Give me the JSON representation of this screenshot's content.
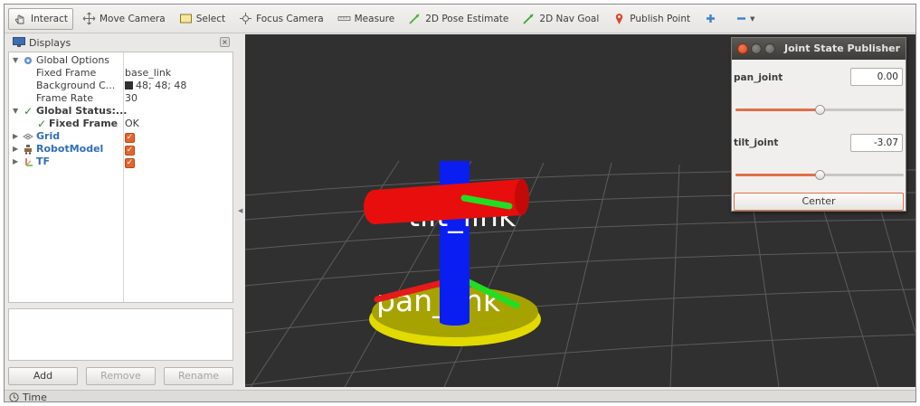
{
  "toolbar": {
    "items": [
      {
        "label": "Interact",
        "icon": "interact-icon"
      },
      {
        "label": "Move Camera",
        "icon": "move-camera-icon"
      },
      {
        "label": "Select",
        "icon": "select-icon"
      },
      {
        "label": "Focus Camera",
        "icon": "focus-camera-icon"
      },
      {
        "label": "Measure",
        "icon": "measure-icon"
      },
      {
        "label": "2D Pose Estimate",
        "icon": "pose-estimate-icon"
      },
      {
        "label": "2D Nav Goal",
        "icon": "nav-goal-icon"
      },
      {
        "label": "Publish Point",
        "icon": "publish-point-icon"
      }
    ],
    "active": "Interact"
  },
  "displays": {
    "title": "Displays",
    "close_glyph": "×",
    "tree": {
      "global_options": "Global Options",
      "fixed_frame_label": "Fixed Frame",
      "fixed_frame_value": "base_link",
      "background_label": "Background C...",
      "background_value": "48; 48; 48",
      "frame_rate_label": "Frame Rate",
      "frame_rate_value": "30",
      "global_status": "Global Status:...",
      "status_fixed_frame_label": "Fixed Frame",
      "status_fixed_frame_value": "OK",
      "grid": "Grid",
      "robot_model": "RobotModel",
      "tf": "TF"
    },
    "buttons": {
      "add": "Add",
      "remove": "Remove",
      "rename": "Rename"
    }
  },
  "viewport": {
    "label_tilt_link": "tilt_link",
    "label_pan_link": "pan_link",
    "background_color": "#303030"
  },
  "joint_state_publisher": {
    "title": "Joint State Publisher",
    "joints": [
      {
        "name": "pan_joint",
        "value": "0.00",
        "slider_fraction": 0.5
      },
      {
        "name": "tilt_joint",
        "value": "-3.07",
        "slider_fraction": 0.5
      }
    ],
    "center_button": "Center"
  },
  "status_bar": {
    "time_label": "Time"
  },
  "colors": {
    "accent": "#e07048",
    "checkbox": "#e4652c",
    "link_blue": "#2f6fb8"
  }
}
